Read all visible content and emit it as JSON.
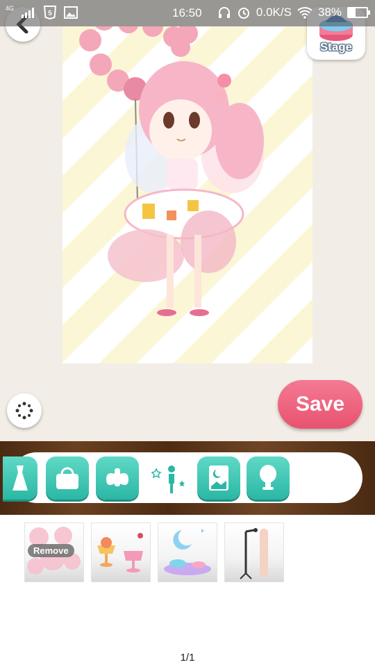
{
  "status_bar": {
    "network": "4G",
    "time": "16:50",
    "speed": "0.0K/S",
    "battery": "38%",
    "battery_level": 0.38
  },
  "buttons": {
    "stage_label": "Stage",
    "save_label": "Save"
  },
  "categories": [
    {
      "name": "dress"
    },
    {
      "name": "bag"
    },
    {
      "name": "fairy-wings"
    },
    {
      "name": "pose"
    },
    {
      "name": "background"
    },
    {
      "name": "wig-stand"
    }
  ],
  "items": [
    {
      "name": "remove",
      "label": "Remove"
    },
    {
      "name": "dessert-set"
    },
    {
      "name": "moon-ornament-set"
    },
    {
      "name": "microphone-stand"
    }
  ],
  "pager": "1/1",
  "colors": {
    "accent_teal": "#2bb7a5",
    "save_pink": "#e8526f",
    "bar_wood": "#5a3518"
  }
}
